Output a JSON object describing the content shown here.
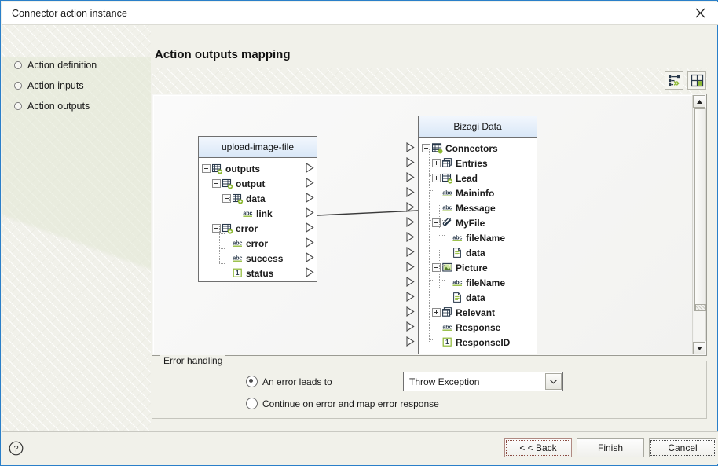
{
  "window": {
    "title": "Connector action instance",
    "close_icon": "close-icon"
  },
  "sidebar": {
    "items": [
      {
        "label": "Action definition"
      },
      {
        "label": "Action inputs"
      },
      {
        "label": "Action outputs"
      }
    ]
  },
  "main": {
    "title": "Action outputs mapping",
    "toolbar": [
      {
        "name": "auto-map-button",
        "icon": "auto-map-icon",
        "tooltip": "Auto map"
      },
      {
        "name": "layout-button",
        "icon": "layout-icon",
        "tooltip": "Layout"
      }
    ]
  },
  "source_tree": {
    "header": "upload-image-file",
    "rows": [
      {
        "label": "outputs",
        "indent": 0,
        "expander": "minus",
        "icon": "table-icon",
        "port": true
      },
      {
        "label": "output",
        "indent": 1,
        "expander": "minus",
        "icon": "table-icon",
        "port": true
      },
      {
        "label": "data",
        "indent": 2,
        "expander": "minus",
        "icon": "table-icon",
        "port": true
      },
      {
        "label": "link",
        "indent": 3,
        "expander": "none",
        "icon": "abc-icon",
        "port": true
      },
      {
        "label": "error",
        "indent": 1,
        "expander": "minus",
        "icon": "table-icon",
        "port": true
      },
      {
        "label": "error",
        "indent": 2,
        "expander": "none",
        "icon": "abc-icon",
        "port": true
      },
      {
        "label": "success",
        "indent": 2,
        "expander": "none",
        "icon": "abc-icon",
        "port": true
      },
      {
        "label": "status",
        "indent": 2,
        "expander": "none",
        "icon": "number-icon",
        "port": true
      }
    ]
  },
  "target_tree": {
    "header": "Bizagi Data",
    "rows": [
      {
        "label": "Connectors",
        "indent": 0,
        "expander": "minus",
        "icon": "grid-icon",
        "port": true
      },
      {
        "label": "Entries",
        "indent": 1,
        "expander": "plus",
        "icon": "collection-icon",
        "port": true
      },
      {
        "label": "Lead",
        "indent": 1,
        "expander": "plus",
        "icon": "table-icon",
        "port": true
      },
      {
        "label": "Maininfo",
        "indent": 1,
        "expander": "none",
        "icon": "abc-icon",
        "port": true
      },
      {
        "label": "Message",
        "indent": 1,
        "expander": "none",
        "icon": "abc-icon",
        "port": true
      },
      {
        "label": "MyFile",
        "indent": 1,
        "expander": "minus",
        "icon": "paperclip-icon",
        "port": true
      },
      {
        "label": "fileName",
        "indent": 2,
        "expander": "none",
        "icon": "abc-icon",
        "port": true
      },
      {
        "label": "data",
        "indent": 2,
        "expander": "none",
        "icon": "document-icon",
        "port": true
      },
      {
        "label": "Picture",
        "indent": 1,
        "expander": "minus",
        "icon": "image-icon",
        "port": true
      },
      {
        "label": "fileName",
        "indent": 2,
        "expander": "none",
        "icon": "abc-icon",
        "port": true
      },
      {
        "label": "data",
        "indent": 2,
        "expander": "none",
        "icon": "document-icon",
        "port": true
      },
      {
        "label": "Relevant",
        "indent": 1,
        "expander": "plus",
        "icon": "collection-icon",
        "port": true
      },
      {
        "label": "Response",
        "indent": 1,
        "expander": "none",
        "icon": "abc-icon",
        "port": true
      },
      {
        "label": "ResponseID",
        "indent": 1,
        "expander": "none",
        "icon": "number-icon",
        "port": true
      }
    ]
  },
  "mapping_links": [
    {
      "from": "link",
      "to": "Message"
    }
  ],
  "error_handling": {
    "legend": "Error handling",
    "option_1": "An error leads to",
    "option_1_selected": true,
    "option_2": "Continue on error and map error response",
    "option_2_selected": false,
    "dropdown_value": "Throw Exception"
  },
  "footer": {
    "help_icon": "help-icon",
    "back": "< < Back",
    "finish": "Finish",
    "cancel": "Cancel"
  },
  "colors": {
    "accent_border": "#2a7fc9",
    "tree_header": "#d9e7f7",
    "icon_dark": "#28384a",
    "icon_green": "#8cb832",
    "canvas_bg": "#f7f7f5"
  }
}
